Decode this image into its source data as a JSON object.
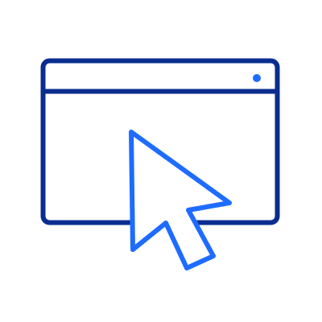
{
  "icon": {
    "name": "browser-window-cursor-icon",
    "parts": [
      "browser-window-icon",
      "mouse-cursor-icon"
    ]
  },
  "colors": {
    "background": "#ffffff",
    "window_outline": "#0a2d8f",
    "cursor_outline": "#1e6cff",
    "cursor_fill": "#ffffff"
  }
}
